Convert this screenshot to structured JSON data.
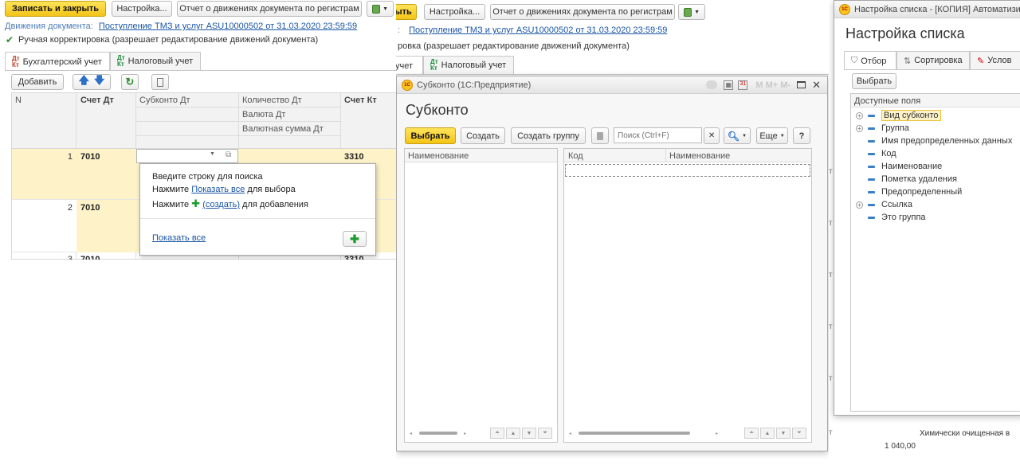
{
  "left": {
    "toolbar": {
      "save_close": "Записать и закрыть",
      "settings": "Настройка...",
      "report": "Отчет о движениях документа по регистрам"
    },
    "movements_label": "Движения документа:",
    "movements_link": "Поступление ТМЗ и услуг ASU10000502 от 31.03.2020 23:59:59",
    "manual_edit": "Ручная корректировка (разрешает редактирование движений документа)",
    "tabs": [
      "Бухгалтерский учет",
      "Налоговый учет"
    ],
    "tab_icon": "Дт Кт",
    "add_button": "Добавить",
    "columns": {
      "n": "N",
      "dt": "Счет Дт",
      "subconto": "Субконто Дт",
      "qty": "Количество Дт",
      "currency": "Валюта Дт",
      "cur_sum": "Валютная сумма Дт",
      "kt": "Счет Кт"
    },
    "rows": [
      {
        "n": "1",
        "dt": "7010",
        "kt": "3310"
      },
      {
        "n": "2",
        "dt": "7010",
        "kt": ""
      },
      {
        "n": "3",
        "dt": "7010",
        "kt": "3310"
      }
    ],
    "dropdown": {
      "line1": "Введите строку для поиска",
      "line2_pre": "Нажмите ",
      "line2_link": "Показать все",
      "line2_post": " для выбора",
      "line3_pre": "Нажмите ",
      "line3_link": "(создать)",
      "line3_post": " для добавления",
      "show_all": "Показать все"
    }
  },
  "middle": {
    "toolbar_fragment": "ыть",
    "settings": "Настройка...",
    "report": "Отчет о движениях документа по регистрам",
    "movements_fragment": ":",
    "movements_link": "Поступление ТМЗ и услуг ASU10000502 от 31.03.2020 23:59:59",
    "manual_fragment": "ровка (разрешает редактирование движений документа)",
    "tab_fragment": "учет",
    "tab2": "Налоговый учет"
  },
  "subconto": {
    "window_title": "Субконто  (1С:Предприятие)",
    "title_controls": "M  M+  M-",
    "title": "Субконто",
    "select": "Выбрать",
    "create": "Создать",
    "create_group": "Создать группу",
    "search_placeholder": "Поиск (Ctrl+F)",
    "more": "Еще",
    "help": "?",
    "left_col": "Наименование",
    "right_cols": [
      "Код",
      "Наименование"
    ]
  },
  "settings_win": {
    "window_title": "Настройка списка - [КОПИЯ] Автоматизи",
    "title": "Настройка списка",
    "tabs": [
      "Отбор",
      "Сортировка",
      "Услов"
    ],
    "select": "Выбрать",
    "fields_header": "Доступные поля",
    "fields": [
      {
        "label": "Вид субконто",
        "expandable": true,
        "selected": true
      },
      {
        "label": "Группа",
        "expandable": true,
        "selected": false
      },
      {
        "label": "Имя предопределенных данных",
        "expandable": false,
        "selected": false
      },
      {
        "label": "Код",
        "expandable": false,
        "selected": false
      },
      {
        "label": "Наименование",
        "expandable": false,
        "selected": false
      },
      {
        "label": "Пометка удаления",
        "expandable": false,
        "selected": false
      },
      {
        "label": "Предопределенный",
        "expandable": false,
        "selected": false
      },
      {
        "label": "Ссылка",
        "expandable": true,
        "selected": false
      },
      {
        "label": "Это группа",
        "expandable": false,
        "selected": false
      }
    ]
  },
  "bottom_right": {
    "text": "Химически очищенная в",
    "amount": "1 040,00"
  },
  "colors": {
    "accent_yellow": "#f5c71a",
    "link_blue": "#1a55a5",
    "row_highlight": "#fdf2c8",
    "add_green": "#1f9a2f"
  }
}
